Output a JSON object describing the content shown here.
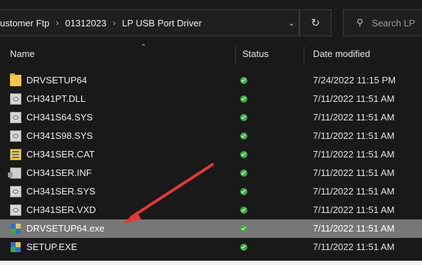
{
  "address": {
    "crumbs": [
      "ustomer Ftp",
      "01312023",
      "LP USB Port Driver"
    ],
    "separator": "›",
    "dropdown_icon": "chevron-down-icon",
    "refresh_icon": "refresh-icon"
  },
  "search": {
    "placeholder": "Search LP"
  },
  "columns": {
    "name": "Name",
    "status": "Status",
    "date": "Date modified"
  },
  "files": [
    {
      "name": "DRVSETUP64",
      "type": "folder",
      "date": "7/24/2022 11:15 PM",
      "selected": false
    },
    {
      "name": "CH341PT.DLL",
      "type": "file",
      "date": "7/11/2022 11:51 AM",
      "selected": false
    },
    {
      "name": "CH341S64.SYS",
      "type": "file",
      "date": "7/11/2022 11:51 AM",
      "selected": false
    },
    {
      "name": "CH341S98.SYS",
      "type": "file",
      "date": "7/11/2022 11:51 AM",
      "selected": false
    },
    {
      "name": "CH341SER.CAT",
      "type": "cat",
      "date": "7/11/2022 11:51 AM",
      "selected": false
    },
    {
      "name": "CH341SER.INF",
      "type": "inf",
      "date": "7/11/2022 11:51 AM",
      "selected": false
    },
    {
      "name": "CH341SER.SYS",
      "type": "file",
      "date": "7/11/2022 11:51 AM",
      "selected": false
    },
    {
      "name": "CH341SER.VXD",
      "type": "file",
      "date": "7/11/2022 11:51 AM",
      "selected": false
    },
    {
      "name": "DRVSETUP64.exe",
      "type": "exe",
      "date": "7/11/2022 11:51 AM",
      "selected": true
    },
    {
      "name": "SETUP.EXE",
      "type": "exe",
      "date": "7/11/2022 11:51 AM",
      "selected": false
    }
  ],
  "colors": {
    "background": "#191919",
    "selected_row": "#777777",
    "status_ok": "#3fae45",
    "annotation_arrow": "#e53935"
  }
}
